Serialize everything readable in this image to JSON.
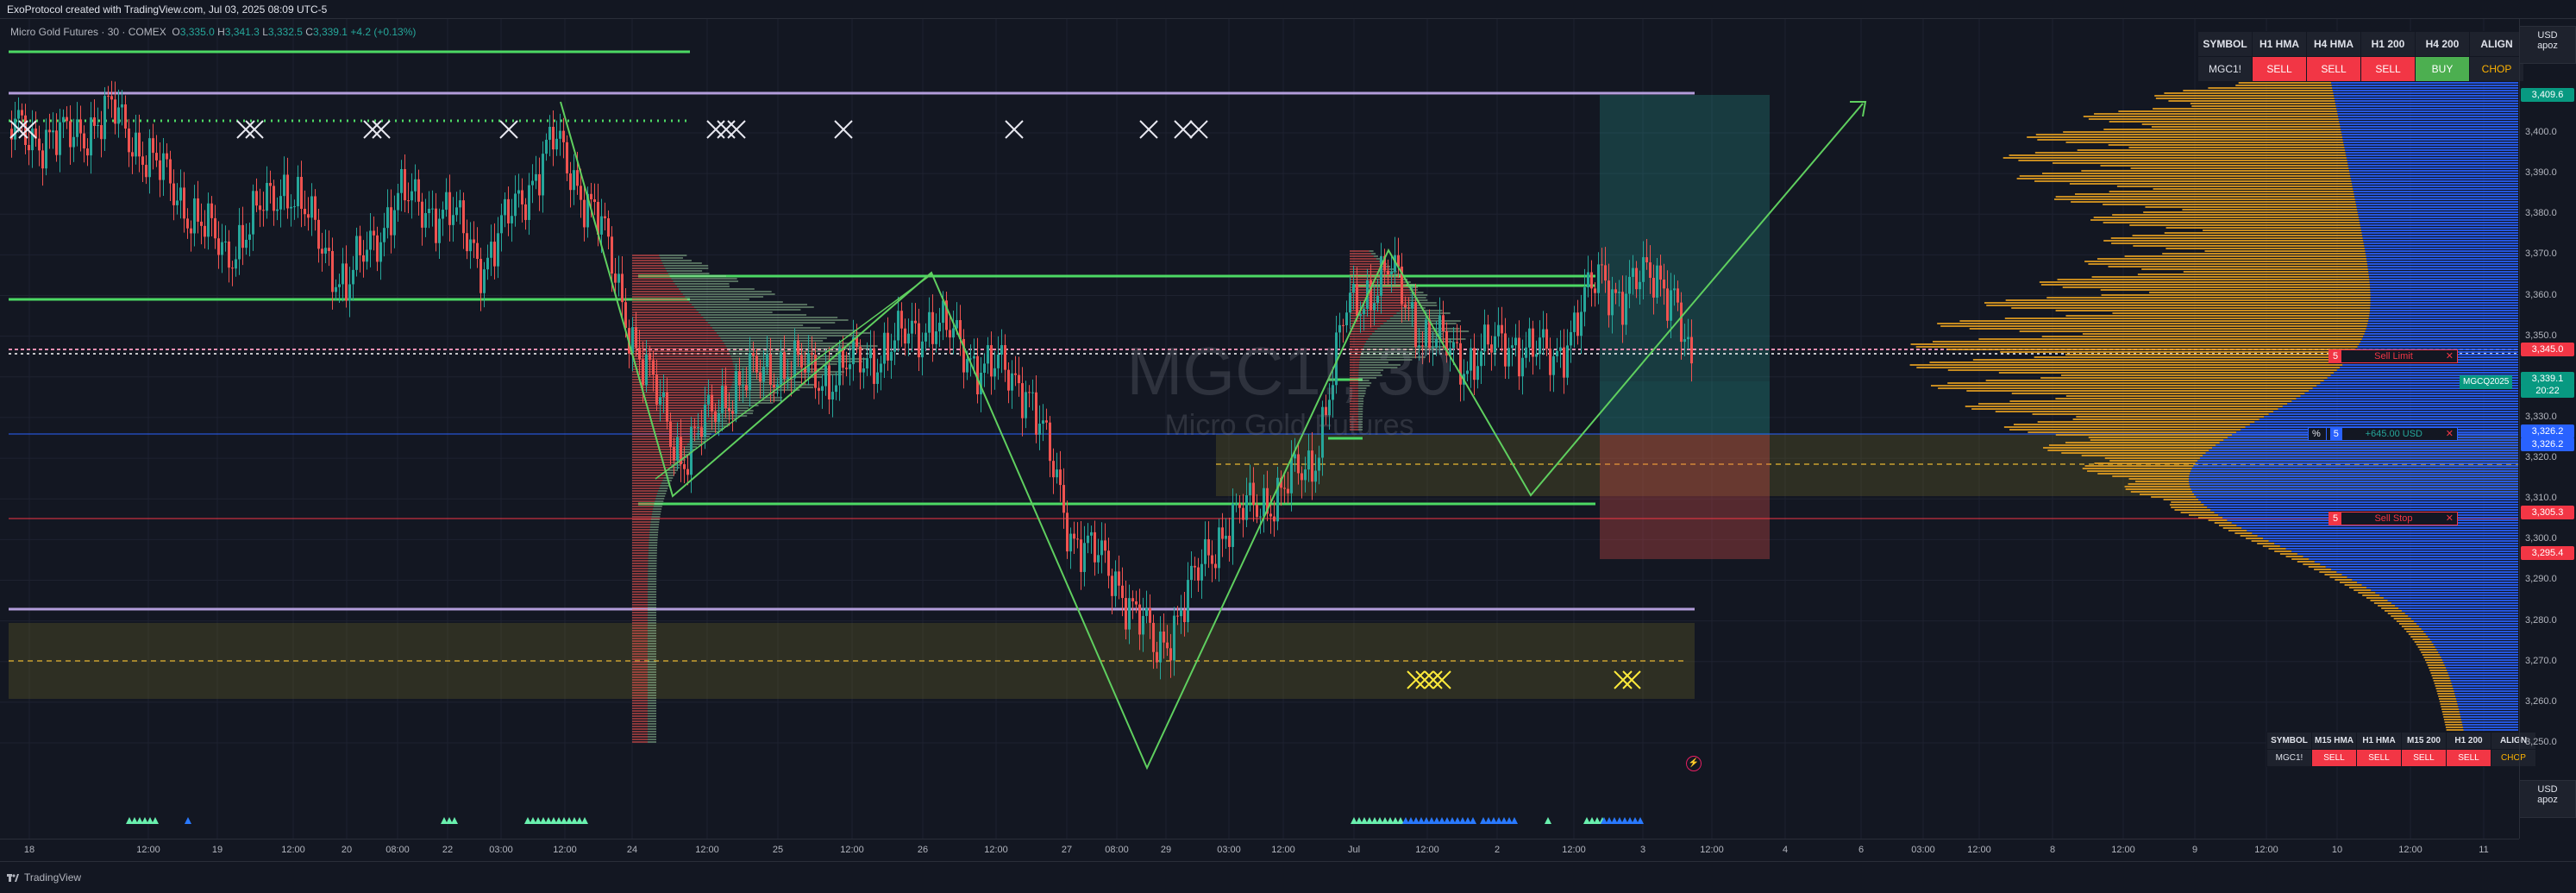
{
  "header": {
    "created_by": "ExoProtocol created with TradingView.com, Jul 03, 2025 08:09 UTC-5"
  },
  "symbol_legend": {
    "name": "Micro Gold Futures · 30 · COMEX",
    "open_label": "O",
    "open": "3,335.0",
    "high_label": "H",
    "high": "3,341.3",
    "low_label": "L",
    "low": "3,332.5",
    "close_label": "C",
    "close": "3,339.1",
    "change": "+4.2 (+0.13%)"
  },
  "watermark": {
    "line1": "MGC1!, 30",
    "line2": "Micro Gold Futures"
  },
  "price_axis": {
    "currency": "USD",
    "unit": "apoz",
    "labels": [
      "3,400.0",
      "3,390.0",
      "3,380.0",
      "3,370.0",
      "3,360.0",
      "3,350.0",
      "3,340.0",
      "3,330.0",
      "3,320.0",
      "3,310.0",
      "3,300.0",
      "3,290.0",
      "3,280.0",
      "3,270.0",
      "3,260.0",
      "3,250.0"
    ],
    "tags": [
      {
        "text": "3,409.6",
        "color": "#089981"
      },
      {
        "text": "3,345.0",
        "color": "#f23645"
      },
      {
        "text": "3,339.1",
        "color": "#089981"
      },
      {
        "text": "20:22",
        "color": "#089981"
      },
      {
        "text": "3,326.2",
        "color": "#2962ff"
      },
      {
        "text": "3,326.2",
        "color": "#2962ff"
      },
      {
        "text": "3,305.3",
        "color": "#f23645"
      },
      {
        "text": "3,295.4",
        "color": "#f23645"
      }
    ],
    "contract_tag": "MGCQ2025"
  },
  "bottom_corner": {
    "currency": "USD",
    "unit": "apoz"
  },
  "time_axis": {
    "labels": [
      "18",
      "12:00",
      "19",
      "12:00",
      "20",
      "08:00",
      "22",
      "03:00",
      "12:00",
      "24",
      "12:00",
      "25",
      "12:00",
      "26",
      "12:00",
      "27",
      "08:00",
      "29",
      "03:00",
      "12:00",
      "Jul",
      "12:00",
      "2",
      "12:00",
      "3",
      "12:00",
      "4",
      "6",
      "03:00",
      "12:00",
      "8",
      "12:00",
      "9",
      "12:00",
      "10",
      "12:00",
      "11"
    ]
  },
  "orders": {
    "sell_limit": {
      "qty": "5",
      "label": "Sell Limit",
      "close": "✕"
    },
    "position": {
      "pct": "%",
      "qty": "5",
      "pl": "+645.00 USD",
      "close": "✕"
    },
    "sell_stop": {
      "qty": "5",
      "label": "Sell Stop",
      "close": "✕"
    }
  },
  "signal_table_top": {
    "headers": [
      "SYMBOL",
      "H1 HMA",
      "H4 HMA",
      "H1 200",
      "H4 200",
      "ALIGN"
    ],
    "row": [
      "MGC1!",
      "SELL",
      "SELL",
      "SELL",
      "BUY",
      "CHOP"
    ]
  },
  "signal_table_bottom": {
    "headers": [
      "SYMBOL",
      "M15 HMA",
      "H1 HMA",
      "M15 200",
      "H1 200",
      "ALIGN"
    ],
    "row": [
      "MGC1!",
      "SELL",
      "SELL",
      "SELL",
      "SELL",
      "CHOP"
    ]
  },
  "footer": {
    "brand": "TradingView"
  },
  "colors": {
    "background": "#131722",
    "up": "#26a69a",
    "down": "#ef5350",
    "green_line": "#4cd964",
    "lavender_line": "#b39ddb",
    "volume_orange": "#e6a020",
    "volume_blue": "#2962ff"
  }
}
